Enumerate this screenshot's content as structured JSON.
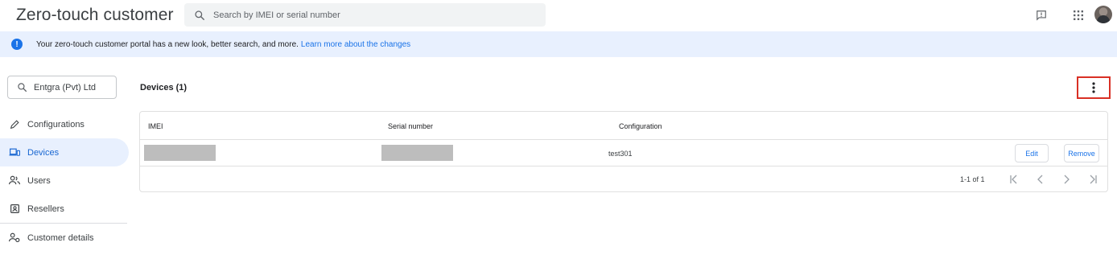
{
  "header": {
    "title": "Zero-touch customer",
    "search_placeholder": "Search by IMEI or serial number",
    "icons": [
      "search-icon",
      "feedback-icon",
      "apps-grid-icon",
      "avatar"
    ]
  },
  "banner": {
    "message": "Your zero-touch customer portal has a new look, better search, and more.",
    "link": "Learn more about the changes"
  },
  "sidebar": {
    "org": "Entgra (Pvt) Ltd",
    "items": [
      {
        "label": "Configurations",
        "icon": "pencil-icon",
        "active": false
      },
      {
        "label": "Devices",
        "icon": "devices-icon",
        "active": true
      },
      {
        "label": "Users",
        "icon": "users-icon",
        "active": false
      },
      {
        "label": "Resellers",
        "icon": "reseller-badge-icon",
        "active": false
      },
      {
        "label": "Customer details",
        "icon": "customer-details-icon",
        "active": false
      }
    ]
  },
  "main": {
    "title": "Devices (1)",
    "table": {
      "columns": [
        "IMEI",
        "Serial number",
        "Configuration"
      ],
      "rows": [
        {
          "imei": "",
          "serial": "",
          "configuration": "test301",
          "edit_label": "Edit",
          "remove_label": "Remove"
        }
      ]
    },
    "pagination": {
      "range": "1-1 of 1"
    }
  },
  "colors": {
    "accent": "#1a73e8",
    "banner_bg": "#e8f0fe",
    "highlight_border": "#d93025"
  }
}
